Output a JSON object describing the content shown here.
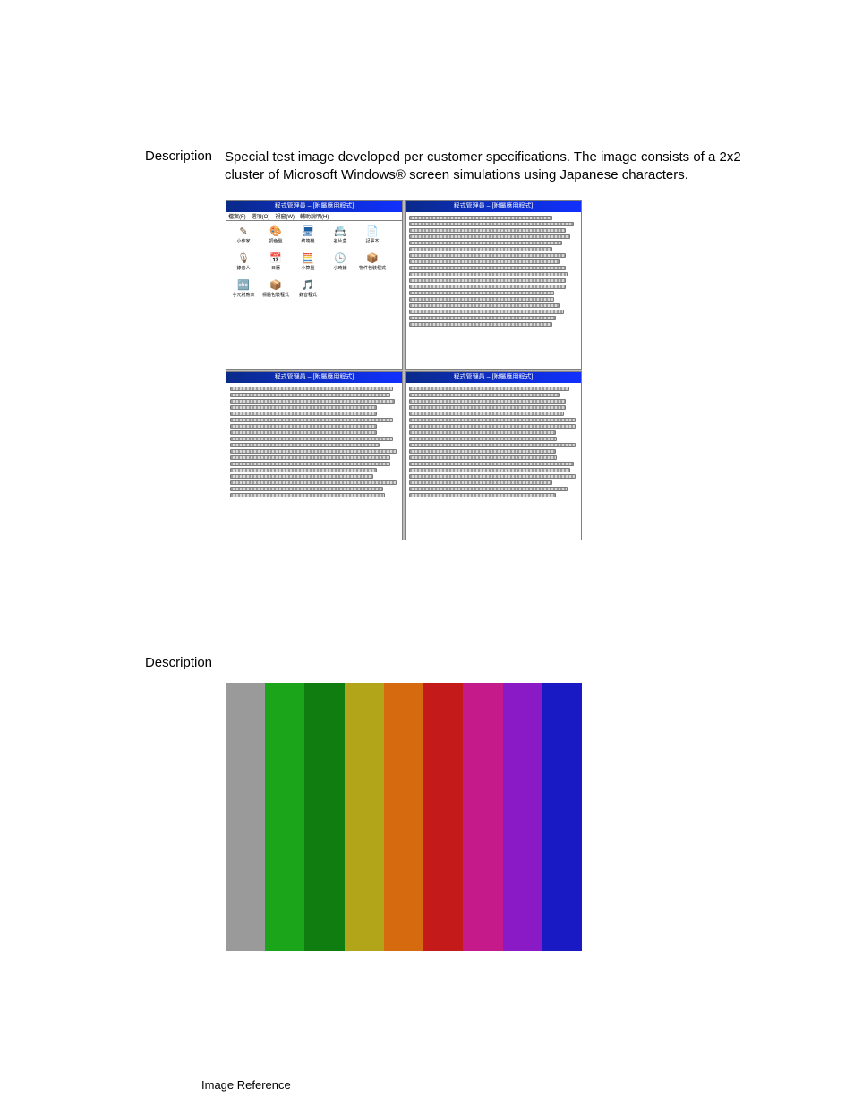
{
  "section1": {
    "label": "Description",
    "text": "Special test image developed per customer specifications. The image consists of a 2x2 cluster of Microsoft Windows® screen simulations using Japanese characters."
  },
  "section2": {
    "label": "Description"
  },
  "footer": {
    "label": "Image Reference"
  },
  "windows_cluster": {
    "titlebar": "程式管理員 – [附屬應用程式]",
    "menus": [
      "檔案(F)",
      "選項(O)",
      "視窗(W)",
      "輔助說明(H)"
    ],
    "icons_pane": [
      {
        "label": "小作家",
        "glyph": "✎",
        "color": "#6a4a2a"
      },
      {
        "label": "調色盤",
        "glyph": "🎨",
        "color": "#c08020"
      },
      {
        "label": "終端機",
        "glyph": "🖥",
        "color": "#2060a0"
      },
      {
        "label": "名片盒",
        "glyph": "📇",
        "color": "#4080c0"
      },
      {
        "label": "記事本",
        "glyph": "📄",
        "color": "#808080"
      },
      {
        "label": "錄音人",
        "glyph": "🎙",
        "color": "#806040"
      },
      {
        "label": "日曆",
        "glyph": "📅",
        "color": "#b03030"
      },
      {
        "label": "小算盤",
        "glyph": "🧮",
        "color": "#208060"
      },
      {
        "label": "小時鐘",
        "glyph": "🕒",
        "color": "#404080"
      },
      {
        "label": "物件包裝程式",
        "glyph": "📦",
        "color": "#806020"
      },
      {
        "label": "字元對應表",
        "glyph": "🔤",
        "color": "#404040"
      },
      {
        "label": "標體包裝程式",
        "glyph": "📦",
        "color": "#604020"
      },
      {
        "label": "錄音程式",
        "glyph": "🎵",
        "color": "#204060"
      }
    ]
  },
  "color_bars": [
    "#9a9a9a",
    "#1aa51a",
    "#0f7d0f",
    "#b3a51a",
    "#d66a0f",
    "#c51a1a",
    "#c51a8a",
    "#8a1ac5",
    "#1a1ac5"
  ]
}
